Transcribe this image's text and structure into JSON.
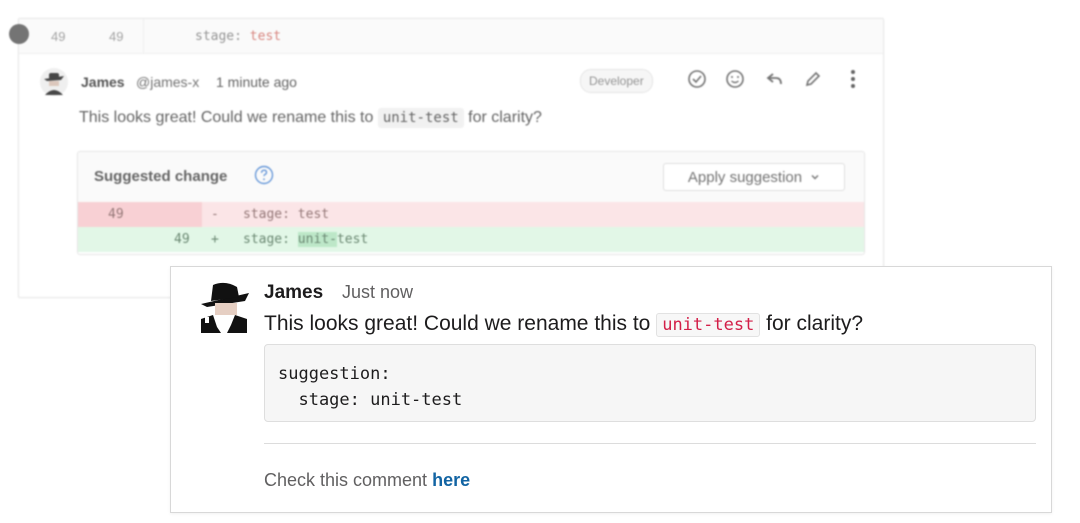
{
  "gitlab": {
    "context_line": {
      "old_number": "49",
      "new_number": "49",
      "code_key": "stage:",
      "code_value": "test"
    },
    "note": {
      "author": "James",
      "handle": "@james-x",
      "time": "1 minute ago",
      "role_badge": "Developer",
      "comment_prefix": "This looks great! Could we rename this to",
      "comment_code": "unit-test",
      "comment_suffix": "for clarity?"
    },
    "suggestion": {
      "title": "Suggested change",
      "apply_label": "Apply suggestion",
      "removed": {
        "old_number": "49",
        "sign": "-",
        "code": "stage: test"
      },
      "added": {
        "new_number": "49",
        "sign": "+",
        "code_prefix": "stage: ",
        "code_highlight": "unit-",
        "code_suffix": "test"
      }
    }
  },
  "slack": {
    "author": "James",
    "time": "Just now",
    "text_prefix": "This looks great! Could we rename this to",
    "text_code": "unit-test",
    "text_suffix": "for clarity?",
    "code_block": "suggestion:\n  stage: unit-test",
    "footer_prefix": "Check this comment",
    "footer_link": "here"
  },
  "icons": {
    "resolve": "check-circle-icon",
    "emoji": "smiley-icon",
    "reply": "reply-icon",
    "edit": "pencil-icon",
    "more": "vertical-ellipsis-icon",
    "help": "question-circle-icon",
    "dropdown": "chevron-down-icon"
  },
  "colors": {
    "removed_bg": "#fbe3e5",
    "added_bg": "#dff7e5",
    "inline_code_red": "#d31f48",
    "link_blue": "#1264a3"
  }
}
